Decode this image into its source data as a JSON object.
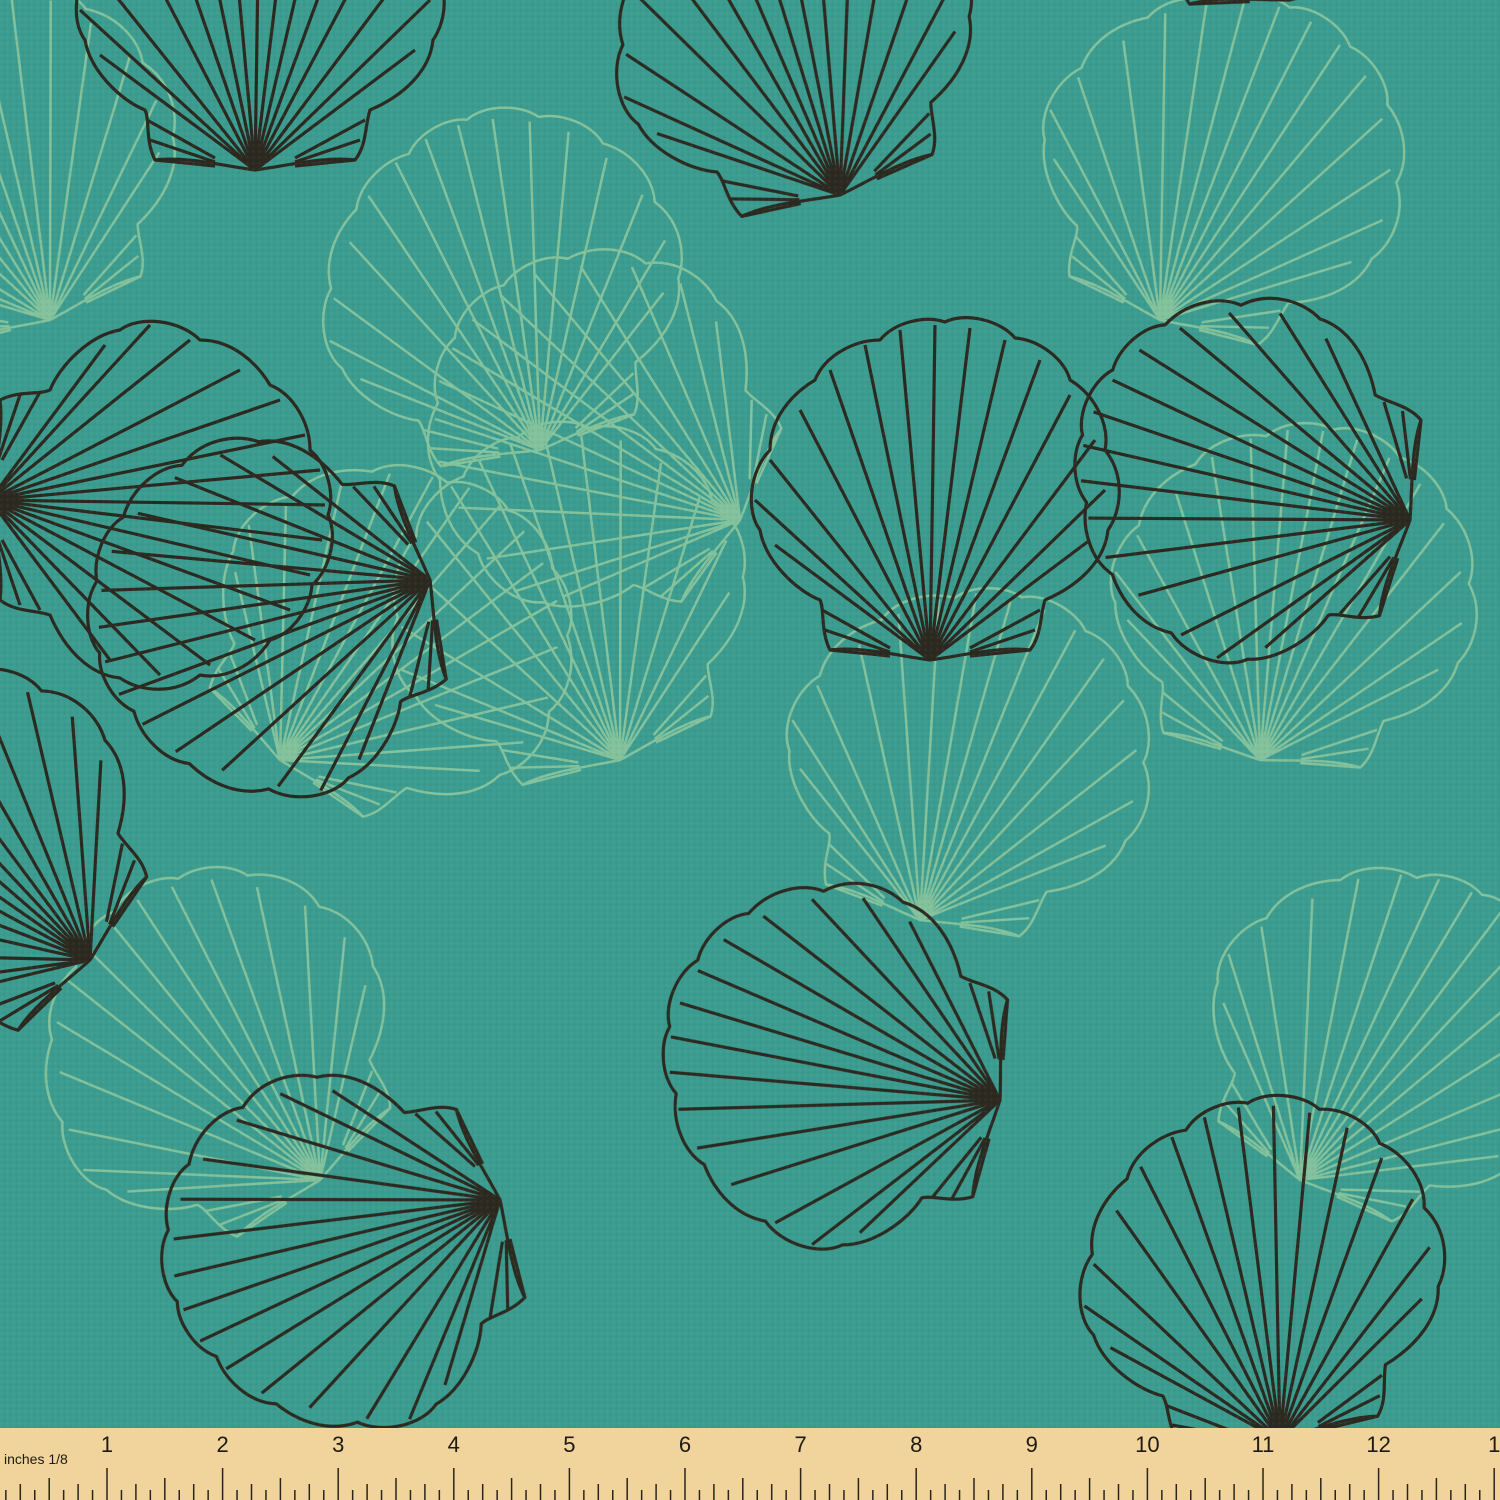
{
  "fabric": {
    "background_color": "#3c9c90",
    "outline_color": "#2c2a20",
    "ghost_color": "#9bcfa0",
    "motif": "scallop-shell"
  },
  "ruler": {
    "unit_label": "inches 1/8",
    "numbers": [
      "1",
      "2",
      "3",
      "4",
      "5",
      "6",
      "7",
      "8",
      "9",
      "10",
      "11",
      "12",
      "1"
    ],
    "color": "#f0d49c"
  }
}
